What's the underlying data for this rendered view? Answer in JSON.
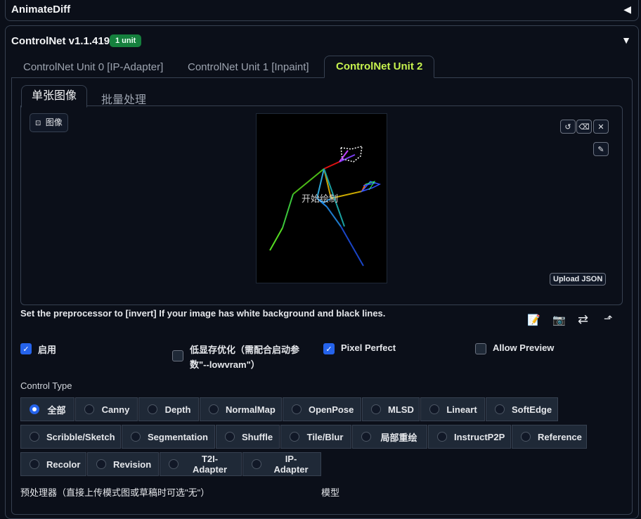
{
  "animatediff": {
    "title": "AnimateDiff",
    "toggle": "◀"
  },
  "controlnet": {
    "title": "ControlNet v1.1.419",
    "badge": "1 unit",
    "toggle": "▼",
    "tabs": [
      "ControlNet Unit 0 [IP-Adapter]",
      "ControlNet Unit 1 [Inpaint]",
      "ControlNet Unit 2"
    ],
    "subtabs": [
      "单张图像",
      "批量处理"
    ],
    "image_label": "图像",
    "canvas_overlay": "开始绘制",
    "upload_json": "Upload JSON",
    "hint": "Set the preprocessor to [invert] If your image has white background and black lines.",
    "checkboxes": {
      "enable": "启用",
      "lowvram": "低显存优化（需配合启动参数\"--lowvram\"）",
      "pixel_perfect": "Pixel Perfect",
      "allow_preview": "Allow Preview"
    },
    "control_type_label": "Control Type",
    "control_types": [
      "全部",
      "Canny",
      "Depth",
      "NormalMap",
      "OpenPose",
      "MLSD",
      "Lineart",
      "SoftEdge",
      "Scribble/Sketch",
      "Segmentation",
      "Shuffle",
      "Tile/Blur",
      "局部重绘",
      "InstructP2P",
      "Reference",
      "Recolor",
      "Revision",
      "T2I-Adapter",
      "IP-Adapter"
    ],
    "preprocessor_label": "预处理器（直接上传模式图或草稿时可选\"无\"）",
    "model_label": "模型"
  },
  "colors": {
    "accent": "#c6f24e",
    "badge": "#15803d",
    "checkbox": "#2563eb"
  },
  "icons": [
    "undo-icon",
    "erase-icon",
    "close-icon",
    "brush-icon",
    "image-icon",
    "notes-icon",
    "camera-icon",
    "swap-icon",
    "send-icon"
  ]
}
